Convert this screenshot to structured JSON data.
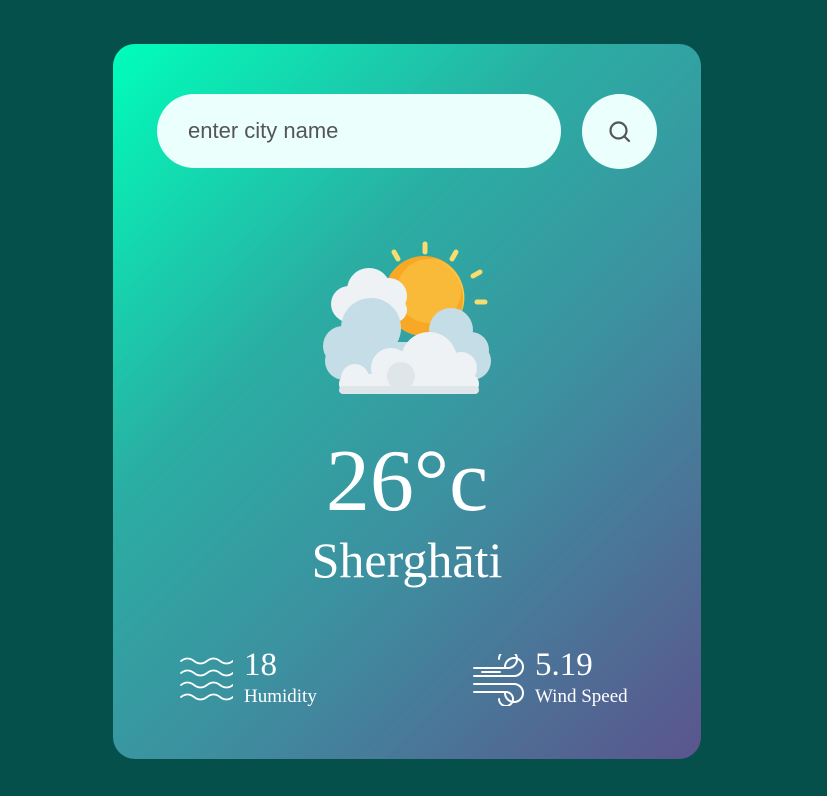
{
  "search": {
    "placeholder": "enter city name",
    "value": "",
    "button_icon": "search-icon"
  },
  "weather": {
    "icon": "partly-cloudy-icon",
    "temperature": "26°c",
    "city": "Sherghāti"
  },
  "details": {
    "humidity": {
      "icon": "humidity-waves-icon",
      "value": "18",
      "label": "Humidity"
    },
    "wind": {
      "icon": "wind-icon",
      "value": "5.19",
      "label": "Wind Speed"
    }
  },
  "colors": {
    "background": "#05504a",
    "card_gradient_start": "#00feba",
    "card_gradient_end": "#5b548e",
    "input_background": "#ebfffc",
    "text": "#ffffff"
  }
}
